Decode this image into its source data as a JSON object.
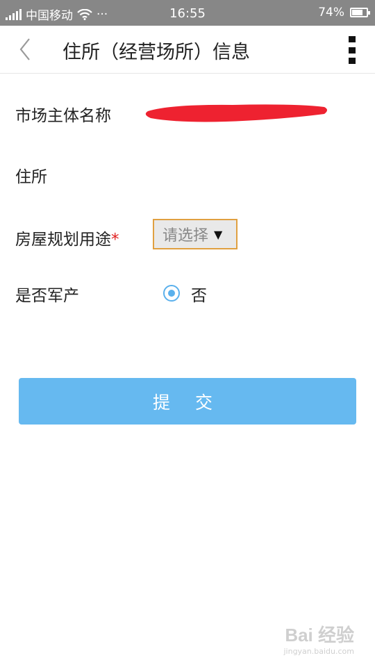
{
  "status_bar": {
    "carrier": "中国移动",
    "dots": "···",
    "time": "16:55",
    "battery_level": "74%",
    "battery_fraction": 0.74
  },
  "header": {
    "title": "住所（经营场所）信息",
    "back_icon": "chevron-left-icon",
    "menu_icon": "vertical-dots-icon"
  },
  "form": {
    "name_label": "市场主体名称",
    "address_label": "住所",
    "usage_label": "房屋规划用途",
    "required_mark": "*",
    "usage_select_value": "请选择",
    "usage_select_arrow": "▼",
    "military_label": "是否军产",
    "military_option": "否",
    "military_selected": true
  },
  "submit_label": "提 交",
  "watermark": {
    "text": "Bai 经验",
    "url_text": "jingyan.baidu.com"
  },
  "colors": {
    "status_bar": "#878787",
    "submit": "#66b9f0",
    "radio": "#5ab0ec",
    "select_border": "#e0a040",
    "required": "#e02020",
    "redaction": "#ee2230"
  }
}
